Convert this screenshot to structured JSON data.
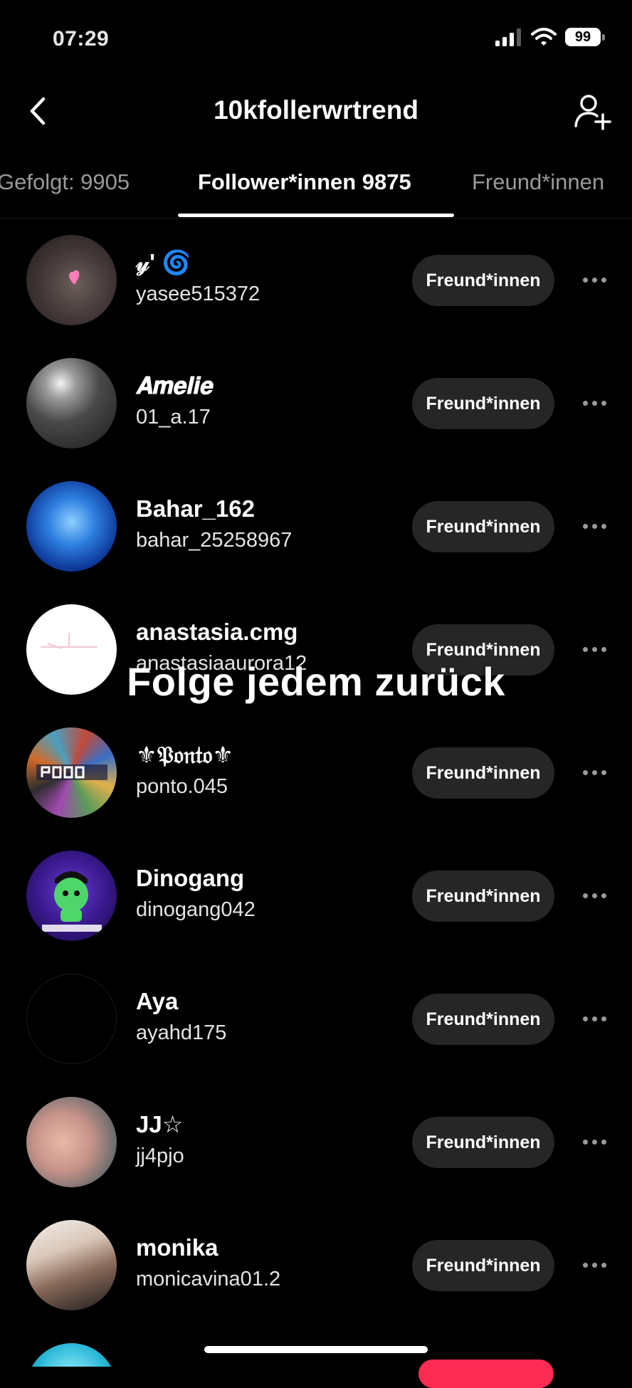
{
  "status_bar": {
    "time": "07:29",
    "battery": "99"
  },
  "header": {
    "title": "10kfollerwrtrend"
  },
  "tabs": [
    {
      "label": "Gefolgt: 9905",
      "active": false
    },
    {
      "label": "Follower*innen 9875",
      "active": true
    },
    {
      "label": "Freund*innen",
      "active": false
    }
  ],
  "followers": [
    {
      "display_name": "𝓎' 🌀",
      "username": "yasee515372",
      "button": "Freund*innen",
      "avatar": "blurred-photo-with-heart"
    },
    {
      "display_name": "𝑨𝒎𝒆𝒍𝒊𝒆",
      "username": "01_a.17",
      "button": "Freund*innen",
      "avatar": "mirror-selfie-grayscale"
    },
    {
      "display_name": "Bahar_162",
      "username": "bahar_25258967",
      "button": "Freund*innen",
      "avatar": "blue-cats-photo"
    },
    {
      "display_name": "anastasia.cmg",
      "username": "anastasiaaurora12",
      "button": "Freund*innen",
      "avatar": "white-avatar"
    },
    {
      "display_name": "⚜𝔓𝔬𝔫𝔱𝔬⚜",
      "username": "ponto.045",
      "button": "Freund*innen",
      "avatar": "2000-collage"
    },
    {
      "display_name": "Dinogang",
      "username": "dinogang042",
      "button": "Freund*innen",
      "avatar": "dino-gang-logo"
    },
    {
      "display_name": "Aya",
      "username": "ayahd175",
      "button": "Freund*innen",
      "avatar": "black-avatar"
    },
    {
      "display_name": "JJ☆",
      "username": "jj4pjo",
      "button": "Freund*innen",
      "avatar": "hand-photo"
    },
    {
      "display_name": "monika",
      "username": "monicavina01.2",
      "button": "Freund*innen",
      "avatar": "portrait-photo"
    }
  ],
  "overlay_caption": "Folge jedem zurück",
  "colors": {
    "background": "#000000",
    "button_bg": "#262626",
    "accent_pink": "#fe2c55"
  }
}
